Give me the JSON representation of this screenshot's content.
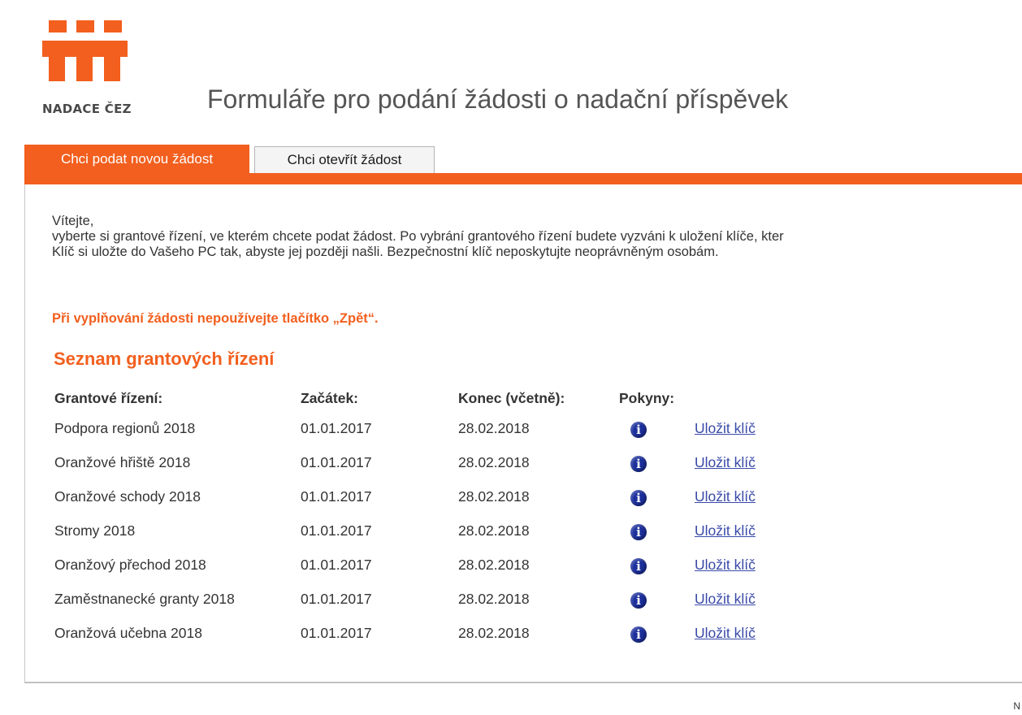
{
  "logo": {
    "text": "NADACE ČEZ",
    "color": "#f25f1e"
  },
  "page_title": "Formuláře pro podání žádosti o nadační příspěvek",
  "tabs": [
    {
      "label": "Chci podat novou žádost",
      "active": true
    },
    {
      "label": "Chci otevřít žádost",
      "active": false
    }
  ],
  "intro": {
    "greeting": "Vítejte,",
    "line1": "vyberte si grantové řízení, ve kterém chcete podat žádost. Po vybrání grantového řízení budete vyzváni k uložení klíče, kter",
    "line2": "Klíč si uložte do Vašeho PC tak, abyste jej později našli. Bezpečnostní klíč neposkytujte neoprávněným osobám."
  },
  "warning": "Při vyplňování žádosti nepoužívejte tlačítko „Zpět“.",
  "list_title": "Seznam grantových řízení",
  "table": {
    "headers": {
      "name": "Grantové řízení:",
      "start": "Začátek:",
      "end": "Konec (včetně):",
      "instructions": "Pokyny:"
    },
    "rows": [
      {
        "name": "Podpora regionů 2018",
        "start": "01.01.2017",
        "end": "28.02.2018",
        "link": "Uložit klíč"
      },
      {
        "name": "Oranžové hřiště 2018",
        "start": "01.01.2017",
        "end": "28.02.2018",
        "link": "Uložit klíč"
      },
      {
        "name": "Oranžové schody 2018",
        "start": "01.01.2017",
        "end": "28.02.2018",
        "link": "Uložit klíč"
      },
      {
        "name": "Stromy 2018",
        "start": "01.01.2017",
        "end": "28.02.2018",
        "link": "Uložit klíč"
      },
      {
        "name": "Oranžový přechod 2018",
        "start": "01.01.2017",
        "end": "28.02.2018",
        "link": "Uložit klíč"
      },
      {
        "name": "Zaměstnanecké granty 2018",
        "start": "01.01.2017",
        "end": "28.02.2018",
        "link": "Uložit klíč"
      },
      {
        "name": "Oranžová učebna 2018",
        "start": "01.01.2017",
        "end": "28.02.2018",
        "link": "Uložit klíč"
      }
    ],
    "info_icon": "info-icon"
  },
  "footer_fragment": "N"
}
